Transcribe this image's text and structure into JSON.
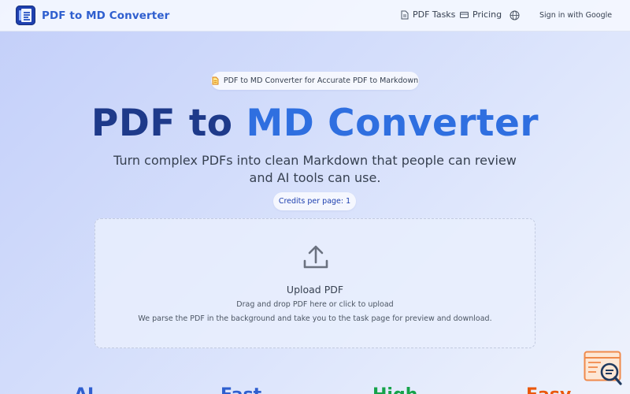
{
  "header": {
    "brand_name": "PDF to MD Converter",
    "nav": {
      "tasks_label": "PDF Tasks",
      "pricing_label": "Pricing",
      "signin_label": "Sign in with Google"
    }
  },
  "hero": {
    "badge_text": "PDF to MD Converter for Accurate PDF to Markdown",
    "headline_part1": "PDF to ",
    "headline_part2": "MD Converter",
    "subtitle": "Turn complex PDFs into clean Markdown that people can review and AI tools can use.",
    "credits_text": "Credits per page: 1"
  },
  "upload": {
    "title": "Upload PDF",
    "hint": "Drag and drop PDF here or click to upload",
    "description": "We parse the PDF in the background and take you to the task page for preview and download."
  },
  "features": [
    "AI",
    "Fast",
    "High",
    "Easy"
  ],
  "icons": {
    "logo": "document-logo-icon",
    "tasks": "document-icon",
    "pricing": "credit-card-icon",
    "language": "globe-icon",
    "badge": "file-text-icon",
    "upload": "upload-icon",
    "widget": "search-window-icon"
  },
  "colors": {
    "brand": "#2f5fcf",
    "headline_dark": "#1e3a8a",
    "headline_accent": "#2f6fe0",
    "feature_green": "#16a34a",
    "feature_orange": "#ea580c"
  }
}
